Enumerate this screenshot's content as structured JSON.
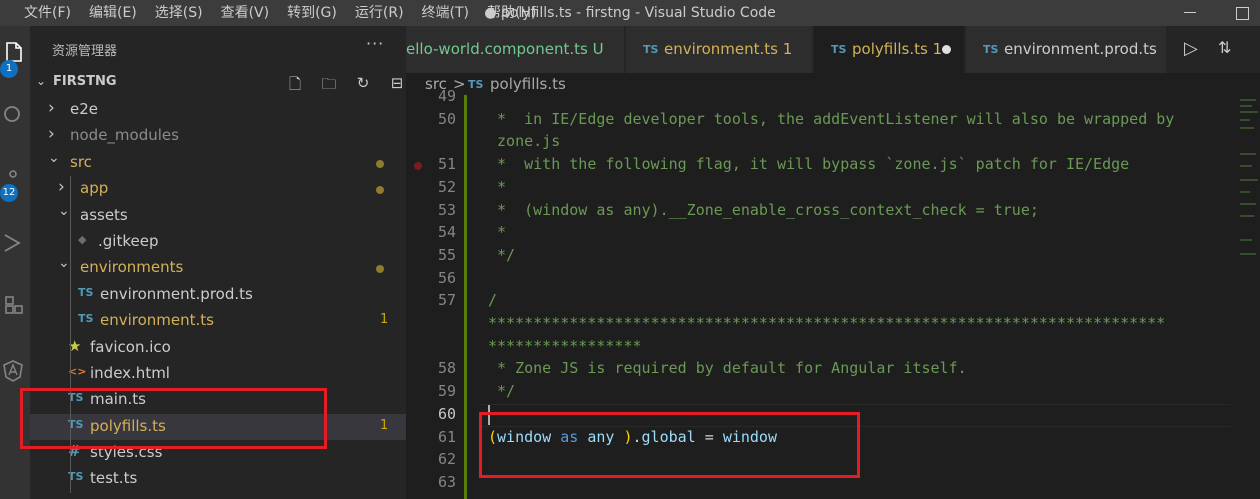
{
  "menu": [
    "文件(F)",
    "编辑(E)",
    "选择(S)",
    "查看(V)",
    "转到(G)",
    "运行(R)",
    "终端(T)",
    "帮助(H)"
  ],
  "window_title": "● polyfills.ts - firstng - Visual Studio Code",
  "activity": {
    "explorer_badge": "1",
    "scm_badge": "12"
  },
  "sidebar": {
    "title": "资源管理器",
    "more": "···",
    "section": "FIRSTNG",
    "tree": [
      {
        "label": "e2e",
        "kind": "folder",
        "indent": 0,
        "open": false
      },
      {
        "label": "node_modules",
        "kind": "folder",
        "indent": 0,
        "open": false,
        "dim": true
      },
      {
        "label": "src",
        "kind": "folder",
        "indent": 0,
        "open": true,
        "mod": true
      },
      {
        "label": "app",
        "kind": "folder",
        "indent": 1,
        "open": false,
        "mod": true
      },
      {
        "label": "assets",
        "kind": "folder",
        "indent": 1,
        "open": true
      },
      {
        "label": ".gitkeep",
        "kind": "gitkeep",
        "indent": 2
      },
      {
        "label": "environments",
        "kind": "folder",
        "indent": 1,
        "open": true,
        "mod": true
      },
      {
        "label": "environment.prod.ts",
        "kind": "ts",
        "indent": 2
      },
      {
        "label": "environment.ts",
        "kind": "ts",
        "indent": 2,
        "mod": true,
        "count": "1"
      },
      {
        "label": "favicon.ico",
        "kind": "fav",
        "indent": 1
      },
      {
        "label": "index.html",
        "kind": "html",
        "indent": 1
      },
      {
        "label": "main.ts",
        "kind": "ts",
        "indent": 1
      },
      {
        "label": "polyfills.ts",
        "kind": "ts",
        "indent": 1,
        "mod": true,
        "count": "1",
        "selected": true
      },
      {
        "label": "styles.css",
        "kind": "css",
        "indent": 1
      },
      {
        "label": "test.ts",
        "kind": "ts",
        "indent": 1
      }
    ]
  },
  "tabs": [
    {
      "label": "ello-world.component.ts",
      "suffix": "U",
      "color": "#73c991",
      "icon": false
    },
    {
      "label": "environment.ts",
      "suffix": "1",
      "color": "#d4b158",
      "icon": true
    },
    {
      "label": "polyfills.ts",
      "suffix": "1",
      "color": "#d4b158",
      "icon": true,
      "active": true
    },
    {
      "label": "environment.prod.ts",
      "suffix": "",
      "color": "#cccccc",
      "icon": true
    }
  ],
  "ts_icon": "TS",
  "breadcrumb": {
    "folder": "src",
    "sep": ">",
    "file": "polyfills.ts"
  },
  "lines": [
    {
      "n": "49",
      "text": ""
    },
    {
      "n": "50",
      "text": " *  in IE/Edge developer tools, the addEventListener will also be wrapped by"
    },
    {
      "n": "",
      "text": " zone.js"
    },
    {
      "n": "51",
      "text": " *  with the following flag, it will bypass `zone.js` patch for IE/Edge"
    },
    {
      "n": "52",
      "text": " *"
    },
    {
      "n": "53",
      "text": " *  (window as any).__Zone_enable_cross_context_check = true;"
    },
    {
      "n": "54",
      "text": " *"
    },
    {
      "n": "55",
      "text": " */"
    },
    {
      "n": "56",
      "text": ""
    },
    {
      "n": "57",
      "text": "/"
    },
    {
      "n": "",
      "text": "***************************************************************************"
    },
    {
      "n": "",
      "text": "*****************"
    },
    {
      "n": "58",
      "text": " * Zone JS is required by default for Angular itself."
    },
    {
      "n": "59",
      "text": " */"
    },
    {
      "n": "60",
      "text": ""
    },
    {
      "n": "61",
      "text": "(window as any ).global = window"
    },
    {
      "n": "62",
      "text": ""
    },
    {
      "n": "63",
      "text": ""
    }
  ]
}
